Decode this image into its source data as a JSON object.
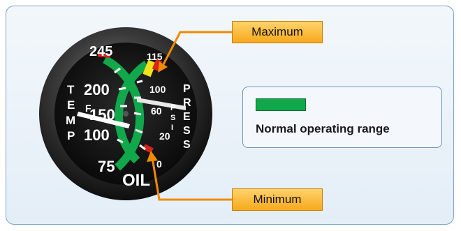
{
  "gauge": {
    "title": "OIL",
    "temp_label": [
      "T",
      "E",
      "M",
      "P"
    ],
    "press_label": [
      "P",
      "R",
      "E",
      "S",
      "S"
    ],
    "temp_unit": "F",
    "press_unit": [
      "P",
      "S",
      "I"
    ],
    "temp_ticks": [
      "245",
      "200",
      "150",
      "100",
      "75"
    ],
    "press_ticks": [
      "115",
      "100",
      "60",
      "20",
      "0"
    ]
  },
  "callouts": {
    "maximum": "Maximum",
    "minimum": "Minimum"
  },
  "legend": {
    "label": "Normal operating range"
  },
  "colors": {
    "normal": "#10a84a",
    "caution": "#f2e21b",
    "limit": "#d8231b",
    "callout": "#f7a91c",
    "arrow": "#f08a00"
  }
}
